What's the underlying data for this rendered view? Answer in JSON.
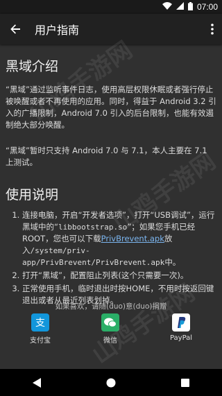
{
  "status_bar": {
    "time": "07:00",
    "icons": [
      "wifi-icon",
      "signal-icon",
      "battery-icon"
    ]
  },
  "app_bar": {
    "title": "用户指南",
    "back_icon": "arrow-back-icon",
    "menu_icon": "more-vert-icon"
  },
  "intro": {
    "heading": "黑域介绍",
    "paragraph1": "“黑域”通过监听事件日志，使用高层权限休眠或者强行停止被唤醒或者不再使用的应用。同时，得益于 Android 3.2 引入的广播限制，Android 7.0 引入的后台限制，也能有效遏制绝大部分唤醒。",
    "paragraph2": "“黑域”暂时只支持 Android 7.0 与 7.1，本人主要在 7.1 上测试。"
  },
  "usage": {
    "heading": "使用说明",
    "step1_a": "连接电脑，开启“开发者选项”，打开“USB调试”，运行黑域中的“",
    "step1_code1": "libbootstrap.so",
    "step1_b": "”；如果您手机已经 ROOT，您也可以下载",
    "step1_link": "PrivBrevent.apk",
    "step1_c": "放入",
    "step1_code2": "/system/priv-app/PrivBrevent/PrivBrevent.apk",
    "step1_d": "中。",
    "step2": "打开“黑域”，配置阻止列表(这个只需要一次)。",
    "step3": "正常使用手机，临时退出时按HOME，不用时按返回键退出或者从最近列表划掉。"
  },
  "donate": {
    "text": "如果喜欢，请随(duo)意(duo)捐赠",
    "options": [
      {
        "label": "支付宝",
        "icon": "alipay-icon",
        "color": "#1296db"
      },
      {
        "label": "微信",
        "icon": "wechat-icon",
        "color": "#2aae67"
      },
      {
        "label": "PayPal",
        "icon": "paypal-icon",
        "color": "#253b80"
      }
    ]
  },
  "watermark": "山鸡手游网",
  "nav_bar": {
    "icons": [
      "back-triangle-icon",
      "home-circle-icon",
      "recents-square-icon"
    ]
  }
}
